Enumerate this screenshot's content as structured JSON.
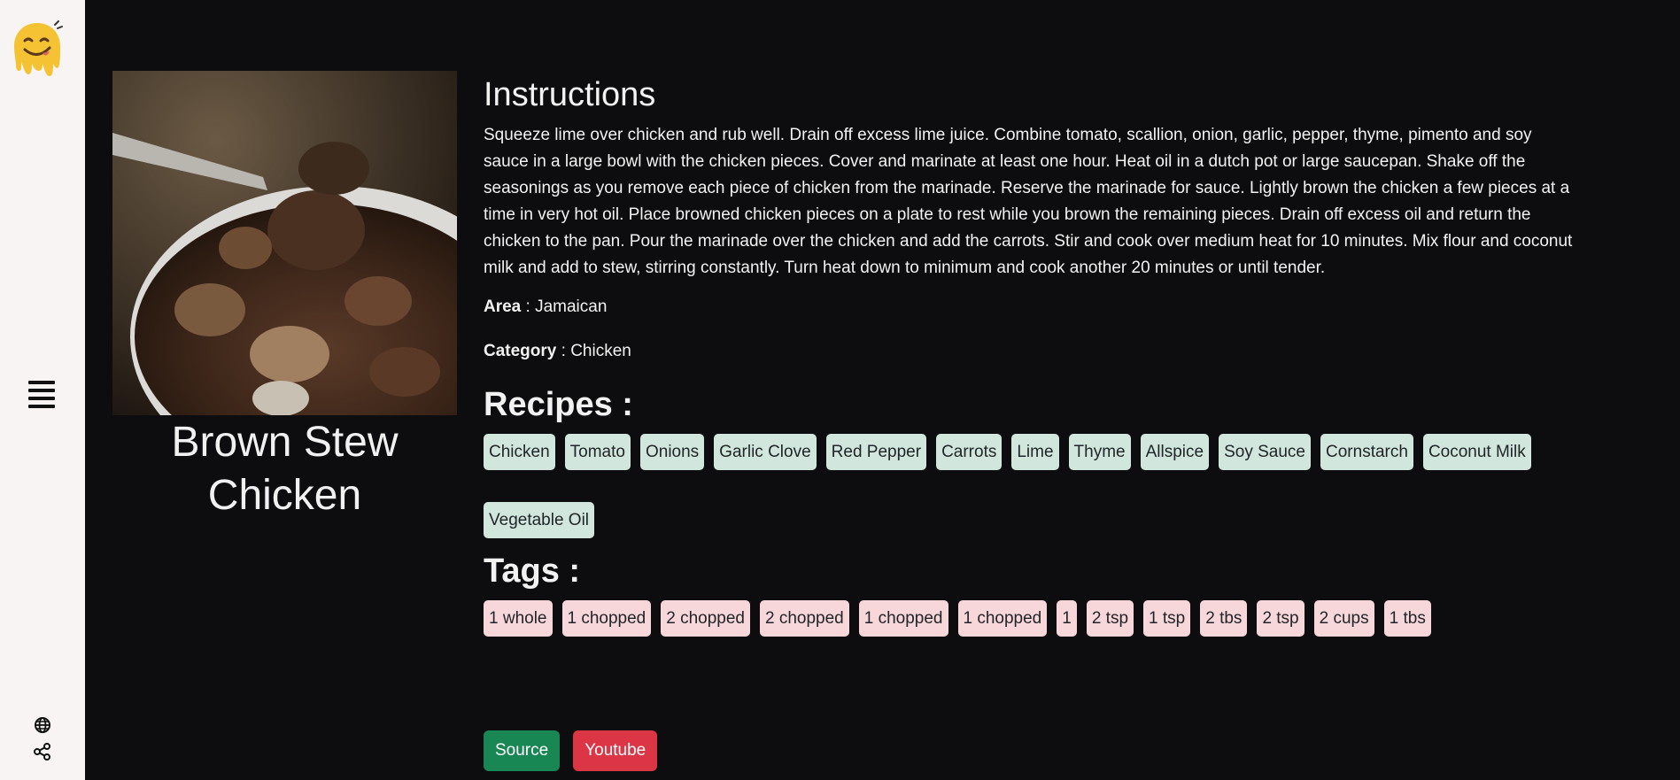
{
  "sidebar": {
    "logo_icon": "smiling-melting-face-logo",
    "menu_icon": "hamburger-menu-icon",
    "globe_icon": "globe-icon",
    "share_icon": "share-icon"
  },
  "meal": {
    "title": "Brown Stew Chicken",
    "image_alt": "Brown Stew Chicken"
  },
  "instructions": {
    "heading": "Instructions",
    "text": "Squeeze lime over chicken and rub well. Drain off excess lime juice. Combine tomato, scallion, onion, garlic, pepper, thyme, pimento and soy sauce in a large bowl with the chicken pieces. Cover and marinate at least one hour. Heat oil in a dutch pot or large saucepan. Shake off the seasonings as you remove each piece of chicken from the marinade. Reserve the marinade for sauce. Lightly brown the chicken a few pieces at a time in very hot oil. Place browned chicken pieces on a plate to rest while you brown the remaining pieces. Drain off excess oil and return the chicken to the pan. Pour the marinade over the chicken and add the carrots. Stir and cook over medium heat for 10 minutes. Mix flour and coconut milk and add to stew, stirring constantly. Turn heat down to minimum and cook another 20 minutes or until tender."
  },
  "area": {
    "label": "Area",
    "separator": " : ",
    "value": "Jamaican"
  },
  "category": {
    "label": "Category",
    "separator": " : ",
    "value": "Chicken"
  },
  "recipes": {
    "heading": "Recipes :",
    "items": [
      "Chicken",
      "Tomato",
      "Onions",
      "Garlic Clove",
      "Red Pepper",
      "Carrots",
      "Lime",
      "Thyme",
      "Allspice",
      "Soy Sauce",
      "Cornstarch",
      "Coconut Milk",
      "Vegetable Oil"
    ]
  },
  "tags": {
    "heading": "Tags :",
    "items": [
      "1 whole",
      "1 chopped",
      "2 chopped",
      "2 chopped",
      "1 chopped",
      "1 chopped",
      "1",
      "2 tsp",
      "1 tsp",
      "2 tbs",
      "2 tsp",
      "2 cups",
      "1 tbs"
    ]
  },
  "actions": {
    "source_label": "Source",
    "youtube_label": "Youtube"
  },
  "colors": {
    "background": "#0d0d0f",
    "sidebar": "#f8f4f4",
    "ingredient_badge": "#d1e7dd",
    "tag_badge": "#f8d7da",
    "source_button": "#198754",
    "youtube_button": "#dc3545"
  }
}
